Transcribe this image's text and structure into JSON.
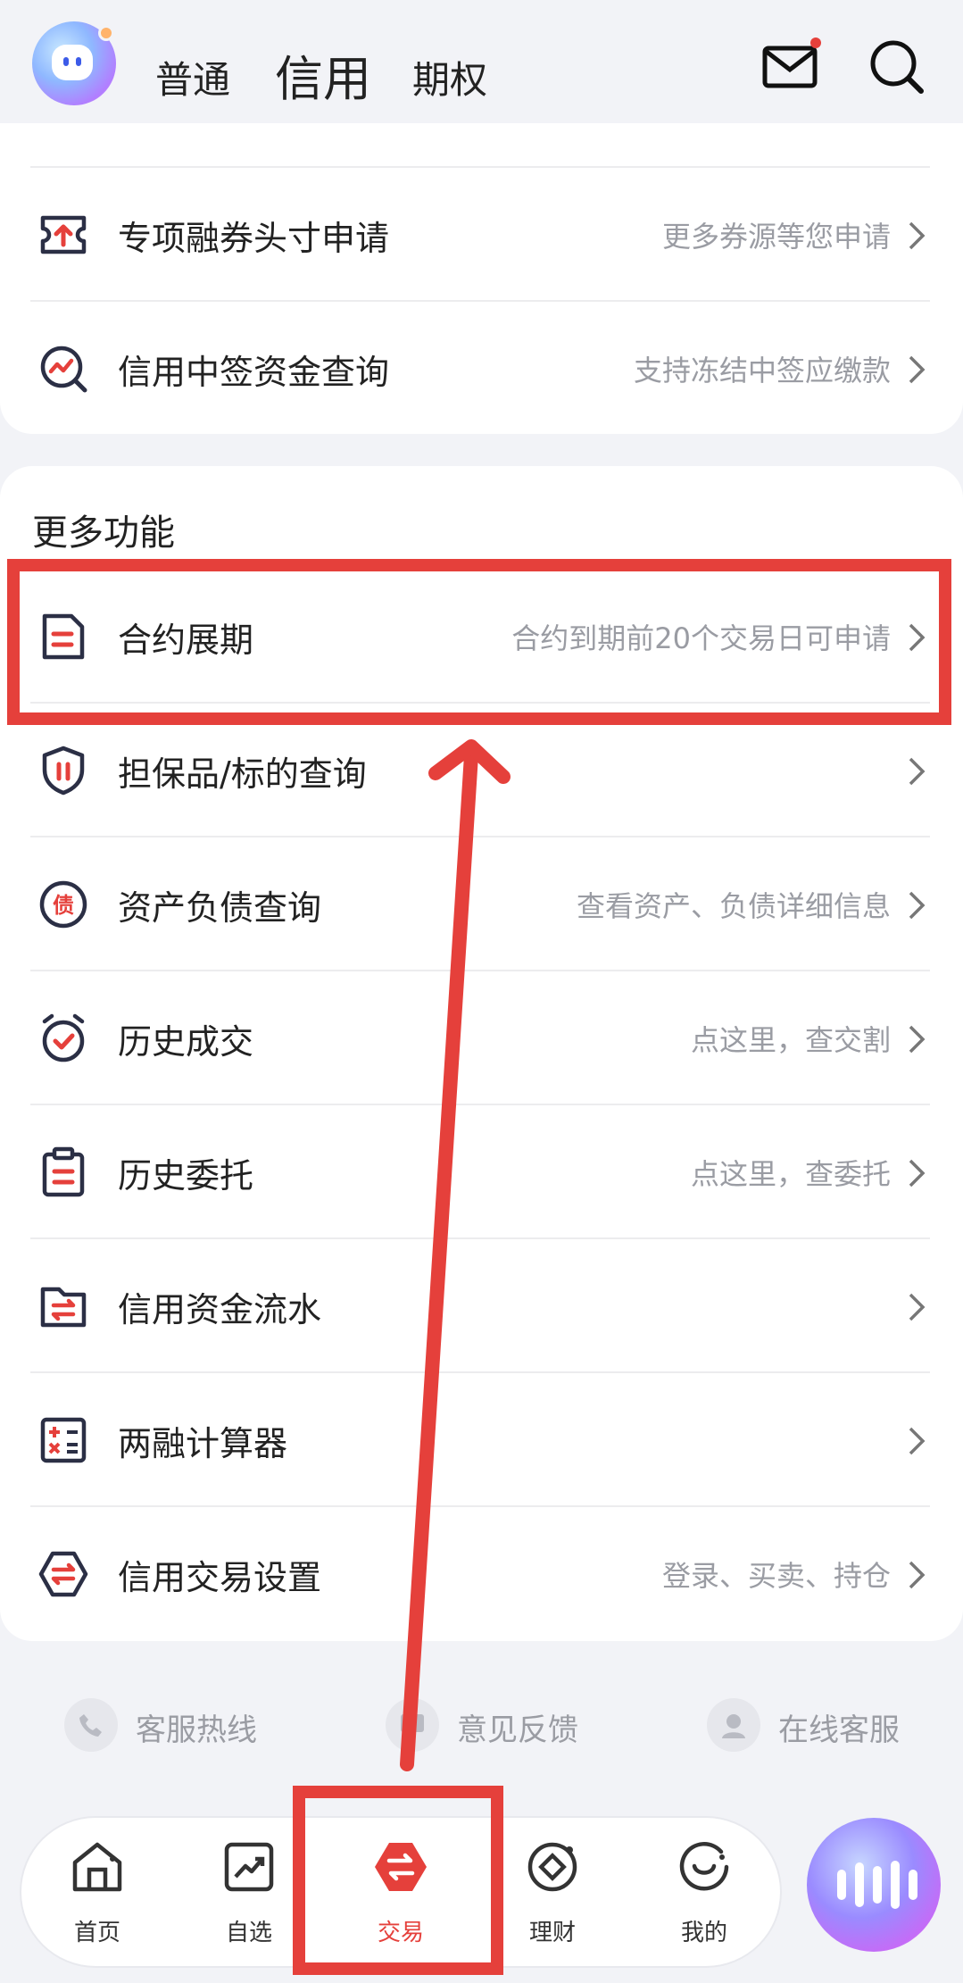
{
  "header": {
    "tabs": [
      "普通",
      "信用",
      "期权"
    ],
    "active_tab": "信用"
  },
  "card1": {
    "rows": [
      {
        "label": "专项融券头寸申请",
        "hint": "更多券源等您申请",
        "icon": "ticket-up-icon"
      },
      {
        "label": "信用中签资金查询",
        "hint": "支持冻结中签应缴款",
        "icon": "chart-search-icon"
      }
    ]
  },
  "more": {
    "title": "更多功能",
    "rows": [
      {
        "label": "合约展期",
        "hint": "合约到期前20个交易日可申请",
        "icon": "document-icon"
      },
      {
        "label": "担保品/标的查询",
        "hint": "",
        "icon": "shield-icon"
      },
      {
        "label": "资产负债查询",
        "hint": "查看资产、负债详细信息",
        "icon": "debt-badge-icon",
        "badge": "债"
      },
      {
        "label": "历史成交",
        "hint": "点这里，查交割",
        "icon": "alarm-check-icon"
      },
      {
        "label": "历史委托",
        "hint": "点这里，查委托",
        "icon": "clipboard-icon"
      },
      {
        "label": "信用资金流水",
        "hint": "",
        "icon": "folder-transfer-icon"
      },
      {
        "label": "两融计算器",
        "hint": "",
        "icon": "calculator-icon"
      },
      {
        "label": "信用交易设置",
        "hint": "登录、买卖、持仓",
        "icon": "settings-transfer-icon"
      }
    ]
  },
  "links": [
    {
      "label": "客服热线",
      "icon": "phone-icon"
    },
    {
      "label": "意见反馈",
      "icon": "feedback-icon"
    },
    {
      "label": "在线客服",
      "icon": "agent-icon"
    }
  ],
  "nav": [
    {
      "label": "首页",
      "icon": "home-icon"
    },
    {
      "label": "自选",
      "icon": "trend-icon"
    },
    {
      "label": "交易",
      "icon": "trade-icon",
      "active": true
    },
    {
      "label": "理财",
      "icon": "wealth-icon"
    },
    {
      "label": "我的",
      "icon": "profile-icon"
    }
  ],
  "colors": {
    "accent": "#e5403b",
    "icon_dark": "#2b2f45",
    "hint": "#9a9ca3"
  }
}
